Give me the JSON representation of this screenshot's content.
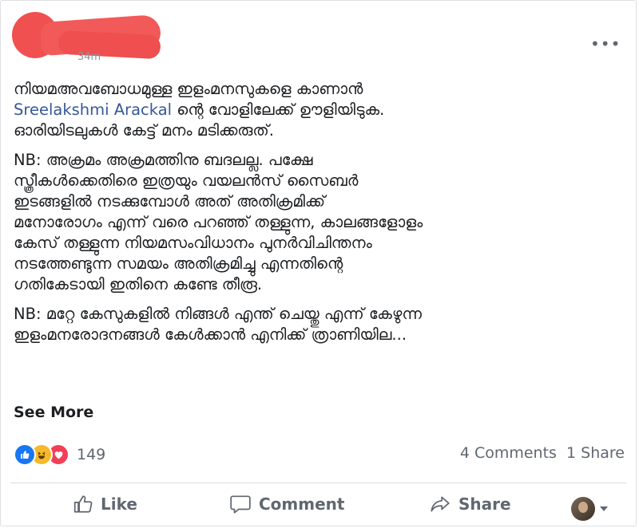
{
  "header": {
    "timestamp": "34m",
    "more_label": "•••"
  },
  "post": {
    "paragraph1_before": "നിയമഅവബോധമുള്ള ഇളംമനസുകളെ കാണാൻ",
    "mention": "Sreelakshmi Arackal",
    "paragraph1_after": " ന്റെ വോളിലേക്ക് ഊളിയിടുക.\nഓരിയിടലുകൾ കേട്ട് മനം മടിക്കരുത്.",
    "paragraph2": "NB: അക്രമം അക്രമത്തിനു ബദലല്ല. പക്ഷേ\nസ്ത്രീകൾക്കെതിരെ ഇത്രയും വയലൻസ് സൈബർ\nഇടങ്ങളിൽ നടക്കുമ്പോൾ അത് അതിക്രമിക്ക്\nമനോരോഗം എന്ന് വരെ പറഞ്ഞ് തള്ളുന്ന,  കാലങ്ങളോളം\nകേസ് തള്ളുന്ന നിയമസംവിധാനം പുനർവിചിന്തനം\nനടത്തേണ്ടുന്ന സമയം അതിക്രമിച്ചു എന്നതിന്റെ\nഗതികേടായി ഇതിനെ കണ്ടേ തീരൂ.",
    "paragraph3": "NB: മറ്റേ കേസുകളിൽ നിങ്ങൾ എന്ത് ചെയ്തു എന്ന് കേഴുന്ന\nഇളംമനരോദനങ്ങൾ കേൾക്കാൻ എനിക്ക് ത്രാണിയില...",
    "see_more": "See More"
  },
  "reactions": {
    "count": "149",
    "icons": [
      "like-icon",
      "haha-icon",
      "love-icon"
    ],
    "colors": {
      "like": "#1877f2",
      "haha": "#f7b928",
      "love": "#f33e58"
    }
  },
  "stats": {
    "comments": "4 Comments",
    "shares": "1 Share"
  },
  "actions": {
    "like": "Like",
    "comment": "Comment",
    "share": "Share"
  }
}
